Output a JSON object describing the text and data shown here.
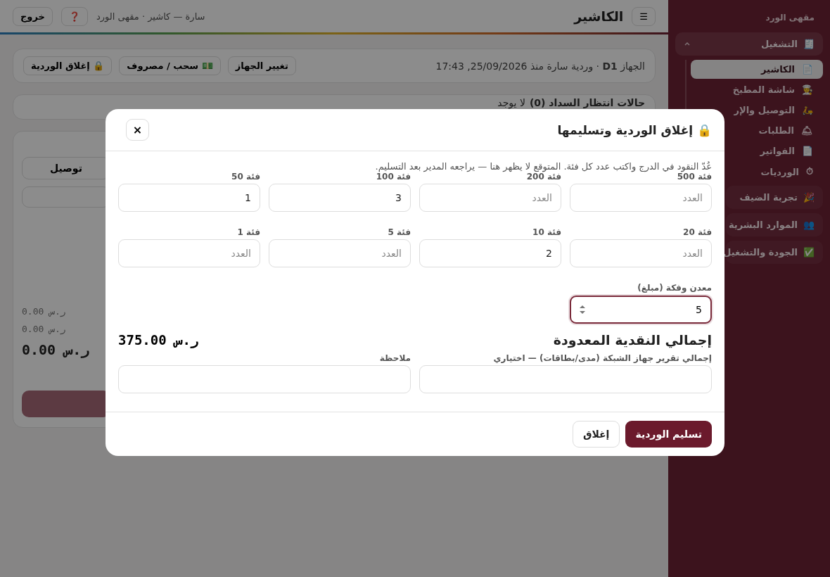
{
  "sidebar": {
    "brand": "مقهى الورد",
    "groups": [
      {
        "icon": "🧾",
        "label": "التشغيل",
        "expanded": true,
        "children": [
          {
            "icon": "📄",
            "label": "الكاشير",
            "selected": true
          },
          {
            "icon": "👨‍🍳",
            "label": "شاشة المطبخ",
            "selected": false
          },
          {
            "icon": "🛵",
            "label": "التوصيل والإر",
            "selected": false
          },
          {
            "icon": "🛎",
            "label": "الطلبات",
            "selected": false
          },
          {
            "icon": "📄",
            "label": "الفواتير",
            "selected": false
          },
          {
            "icon": "⏱",
            "label": "الورديات",
            "selected": false
          }
        ]
      },
      {
        "icon": "🎉",
        "label": "تجربة الضيف",
        "expanded": false
      },
      {
        "icon": "👥",
        "label": "الموارد البشرية",
        "expanded": false
      },
      {
        "icon": "✅",
        "label": "الجودة والتشغيل",
        "expanded": false
      }
    ]
  },
  "topbar": {
    "menu": "☰",
    "title": "الكاشير",
    "user": "سارة — كاشير · مقهى الورد",
    "help": "❓",
    "logout": "خروج"
  },
  "shift_bar": {
    "info": "الجهاز **D1** · وردية سارة منذ 25/09/2026, 17:43",
    "buttons": [
      {
        "label": "تغيير الجهاز"
      },
      {
        "icon": "💵",
        "label": "سحب / مصروف"
      },
      {
        "icon": "🔒",
        "label": "إغلاق الوردية"
      }
    ]
  },
  "pending": {
    "label": "حالات انتظار السداد (0)",
    "value": "لا يوجد"
  },
  "order_panel": {
    "tab": "توصيل",
    "totals": [
      "0.00 ر.س",
      "0.00 ر.س"
    ],
    "grand_total": "0.00 ر.س"
  },
  "modal": {
    "title": "🔒 إغلاق الوردية وتسليمها",
    "close": "×",
    "hint": "عُدّ النقود في الدرج واكتب عدد كل فئة. المتوقع لا يظهر هنا — يراجعه المدير بعد التسليم.",
    "denominations": [
      {
        "label": "فئة 500",
        "placeholder": "العدد"
      },
      {
        "label": "فئة 200",
        "placeholder": "العدد"
      },
      {
        "label": "فئة 100",
        "value": "3"
      },
      {
        "label": "فئة 50",
        "value": "1"
      },
      {
        "label": "فئة 20",
        "placeholder": "العدد"
      },
      {
        "label": "فئة 10",
        "value": "2"
      },
      {
        "label": "فئة 5",
        "placeholder": "العدد"
      },
      {
        "label": "فئة 1",
        "placeholder": "العدد"
      }
    ],
    "coins": {
      "label": "معدن وفكة (مبلغ)",
      "value": "5",
      "focused": true
    },
    "total_label": "إجمالي النقدية المعدودة",
    "total_value": "375.00 ر.س",
    "fields": [
      {
        "label": "إجمالي تقرير جهاز الشبكة (مدى/بطاقات) — اختياري"
      },
      {
        "label": "ملاحظة"
      }
    ],
    "buttons": [
      {
        "kind": "primary",
        "label": "تسليم الوردية"
      },
      {
        "kind": "secondary",
        "label": "إغلاق"
      }
    ]
  }
}
